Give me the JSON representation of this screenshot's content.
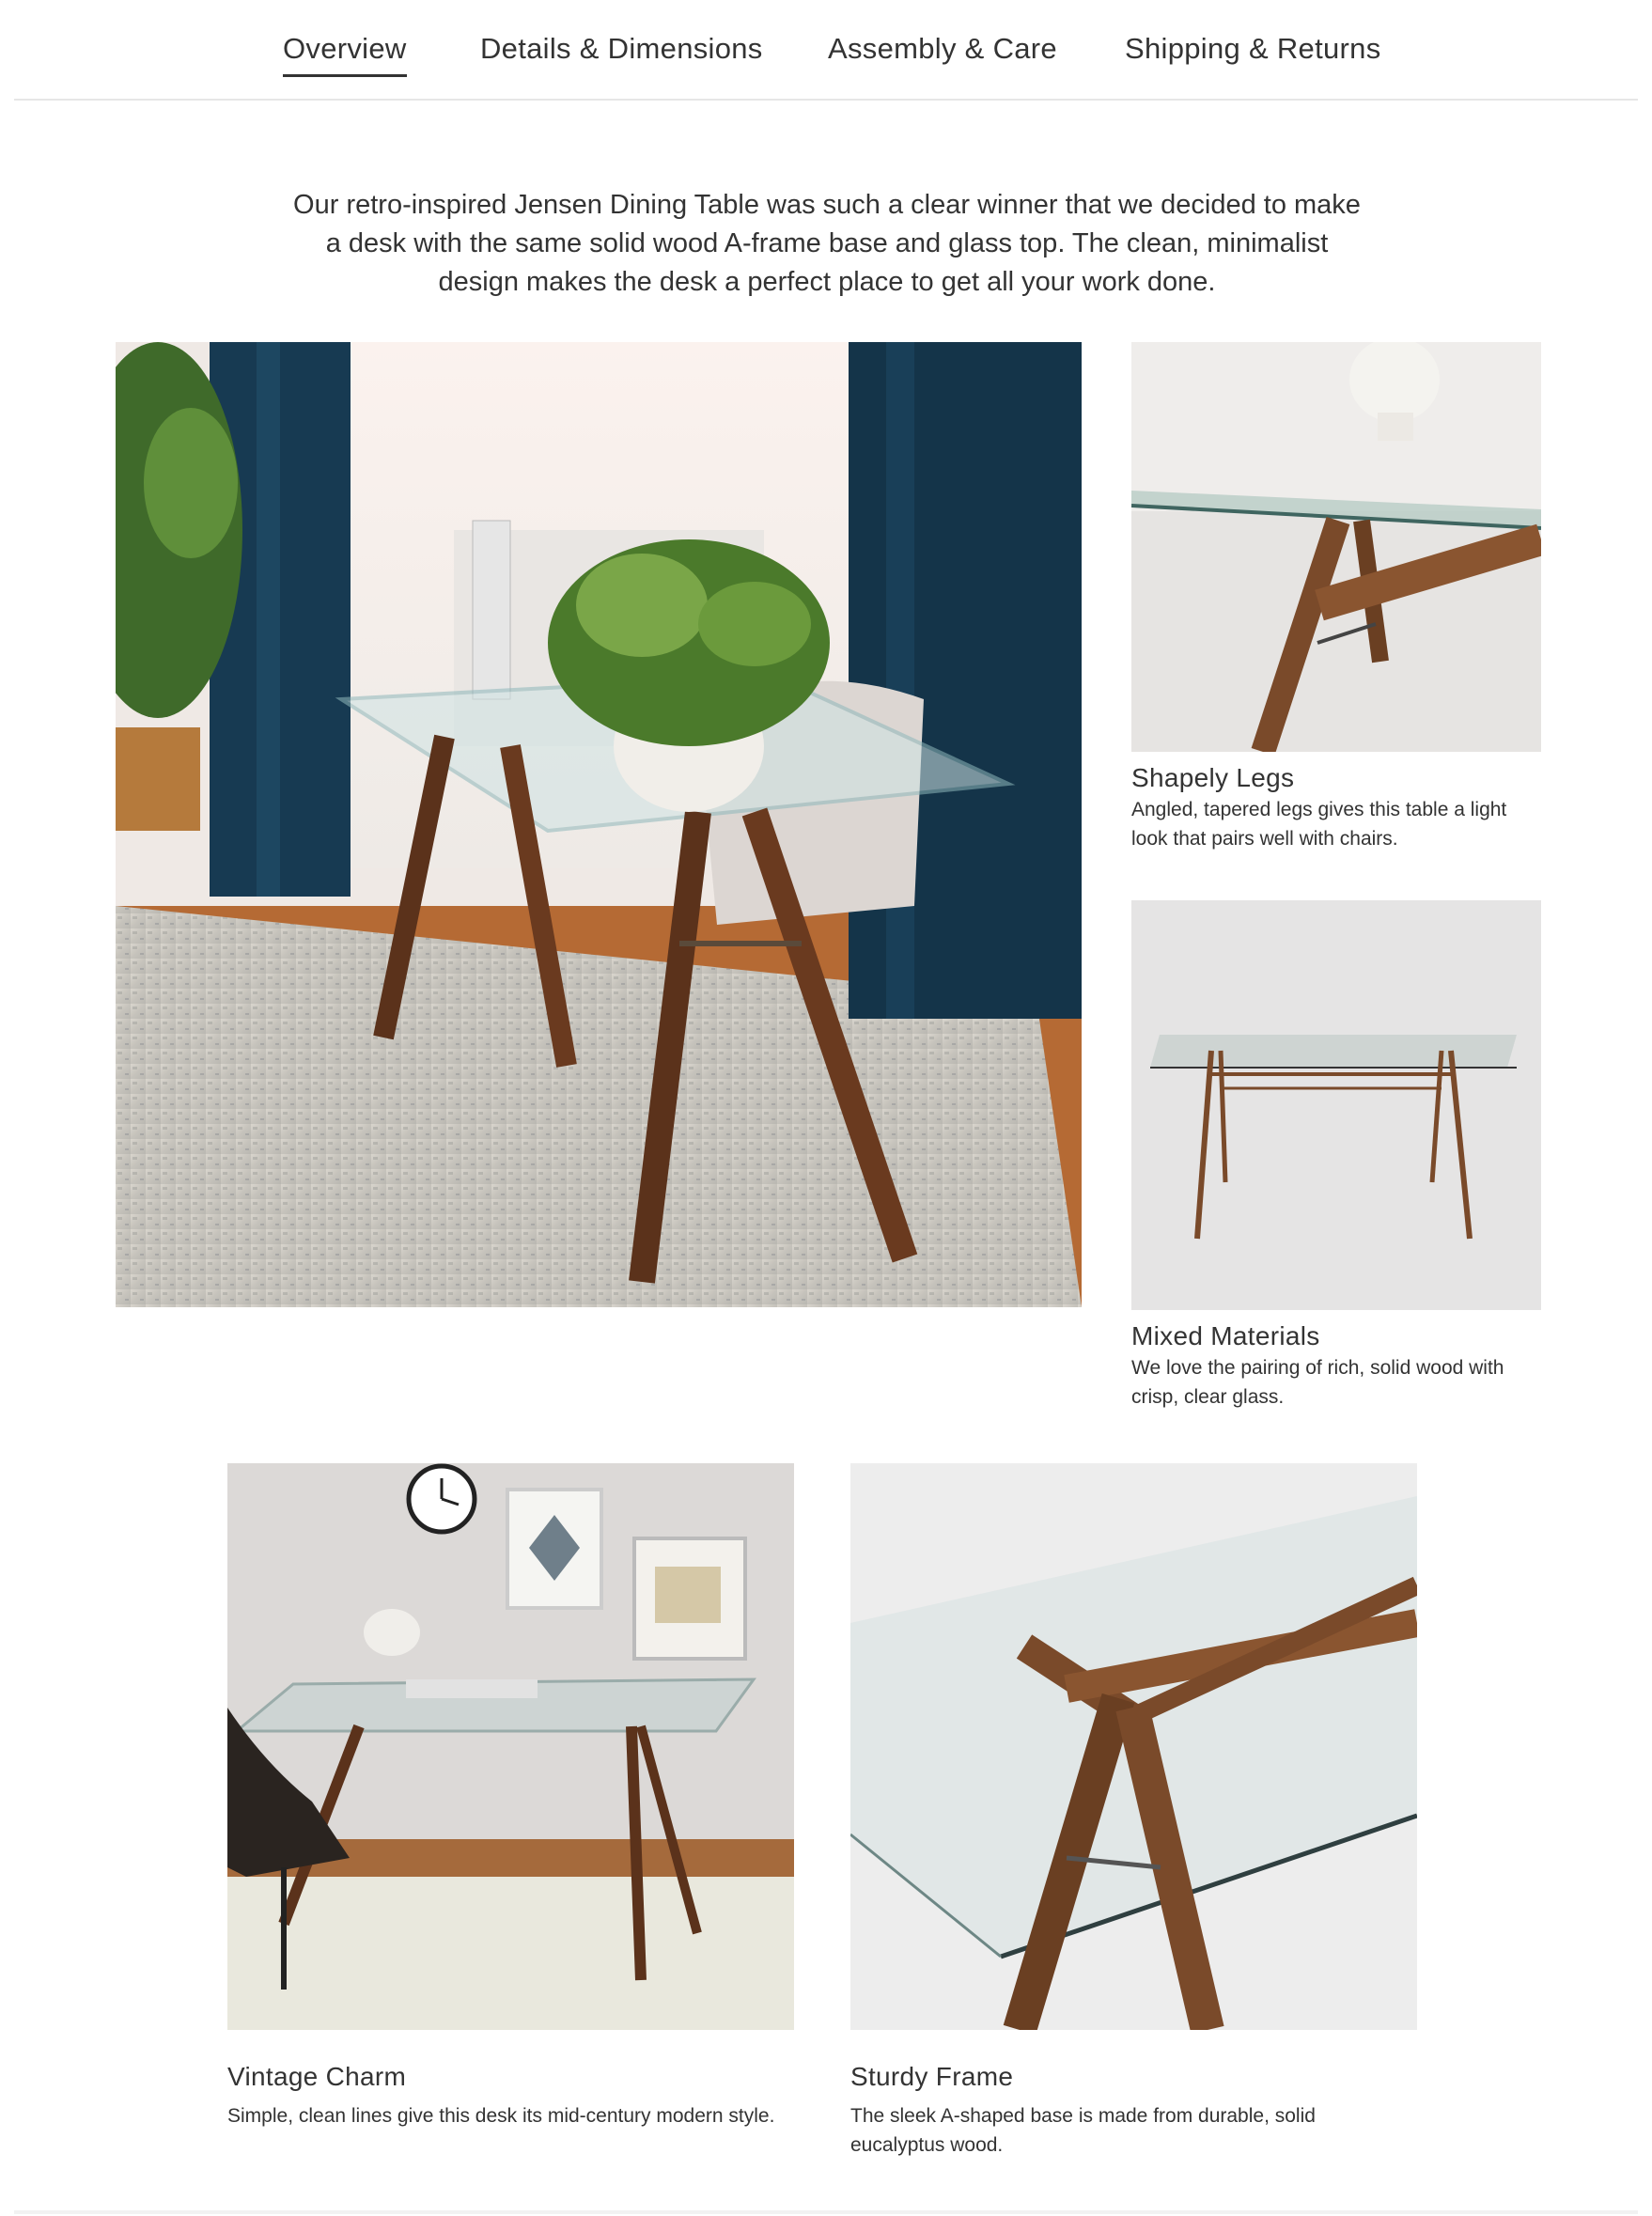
{
  "tabs": [
    {
      "label": "Overview",
      "active": true
    },
    {
      "label": "Details & Dimensions",
      "active": false
    },
    {
      "label": "Assembly & Care",
      "active": false
    },
    {
      "label": "Shipping & Returns",
      "active": false
    }
  ],
  "intro": {
    "text": "Our retro-inspired Jensen Dining Table was such a clear winner that we decided to make a desk with the same solid wood A-frame base and glass top. The clean, minimalist design makes the desk a perfect place to get all your work done."
  },
  "features": [
    {
      "title": "Shapely Legs",
      "description": "Angled, tapered legs gives this table a light look that pairs well with chairs."
    },
    {
      "title": "Mixed Materials",
      "description": "We love the pairing of rich, solid wood with crisp, clear glass."
    },
    {
      "title": "Vintage Charm",
      "description": "Simple, clean lines give this desk its mid-century modern style."
    },
    {
      "title": "Sturdy Frame",
      "description": "The sleek A-shaped base is made from durable, solid eucalyptus wood."
    }
  ],
  "colors": {
    "text": "#333333",
    "divider": "#e6e6e6",
    "walnut": "#7a4a2a",
    "curtain": "#173a52"
  }
}
